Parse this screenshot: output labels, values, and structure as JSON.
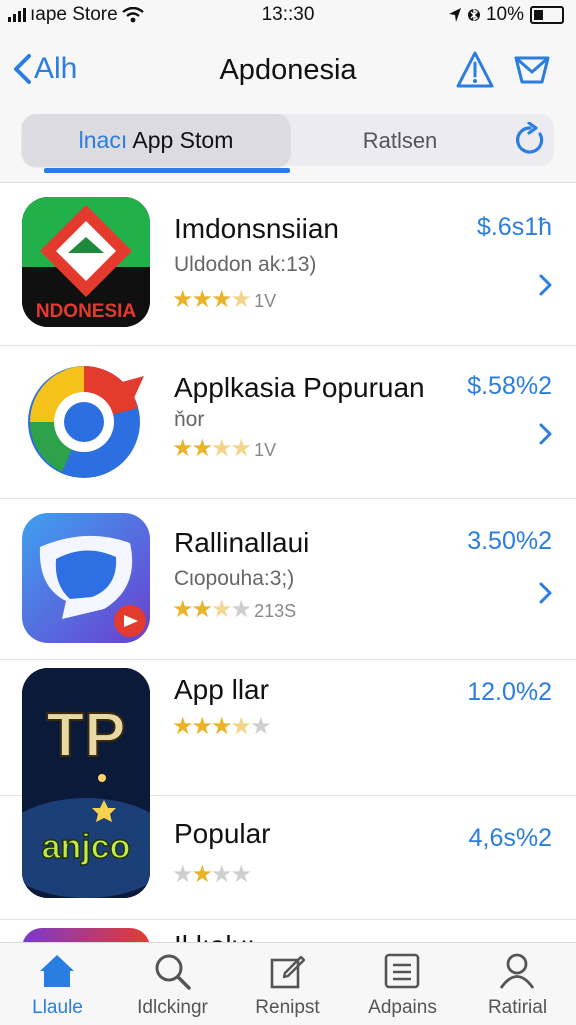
{
  "status_bar": {
    "carrier": "ıape Store",
    "time": "13::30",
    "battery": "10%"
  },
  "nav": {
    "back_label": "Alh",
    "title": "Apdonesia"
  },
  "segments": {
    "active_prefix": "lnacı",
    "active_label": "App Stom",
    "inactive_label": "Ratlsen"
  },
  "apps": [
    {
      "name": "Imdonsnsiian",
      "subtitle": "Uldodon ak:13)",
      "stars": "3.5",
      "rating_count": "1V",
      "price": "$.6s1ħ",
      "icon": "indonesia-flag-diamond-icon"
    },
    {
      "name": "Applkasia Popuruan",
      "subtitle": "ňor",
      "stars": "2.5",
      "rating_count": "1V",
      "price": "$.58%2",
      "icon": "chrome-like-swirl-icon"
    },
    {
      "name": "Rallinallaui",
      "subtitle": "Cιopouha:3;)",
      "stars": "2.5",
      "rating_count": "213S",
      "price": "3.50%2",
      "icon": "blue-chat-bubble-icon"
    },
    {
      "name": "App llar",
      "subtitle": "",
      "stars": "3.5",
      "rating_count": "",
      "price": "12.0%2",
      "icon": "tp-game-icon"
    },
    {
      "name": "Popular",
      "subtitle": "",
      "stars": "1.5",
      "rating_count": "",
      "price": "4,6s%2",
      "icon": "tp-game-icon"
    },
    {
      "name": "Il lıaluı",
      "subtitle": "",
      "stars": "",
      "rating_count": "",
      "price": "",
      "icon": "purple-red-app-icon"
    }
  ],
  "tabs": [
    {
      "label": "Llaule",
      "icon": "home-icon",
      "active": true
    },
    {
      "label": "Idlckingr",
      "icon": "search-icon",
      "active": false
    },
    {
      "label": "Renipst",
      "icon": "edit-square-icon",
      "active": false
    },
    {
      "label": "Adpains",
      "icon": "list-doc-icon",
      "active": false
    },
    {
      "label": "Ratirial",
      "icon": "person-icon",
      "active": false
    }
  ],
  "colors": {
    "accent": "#2a7de1",
    "star": "#e9b32a",
    "bar_bg": "#f7f7f7"
  }
}
